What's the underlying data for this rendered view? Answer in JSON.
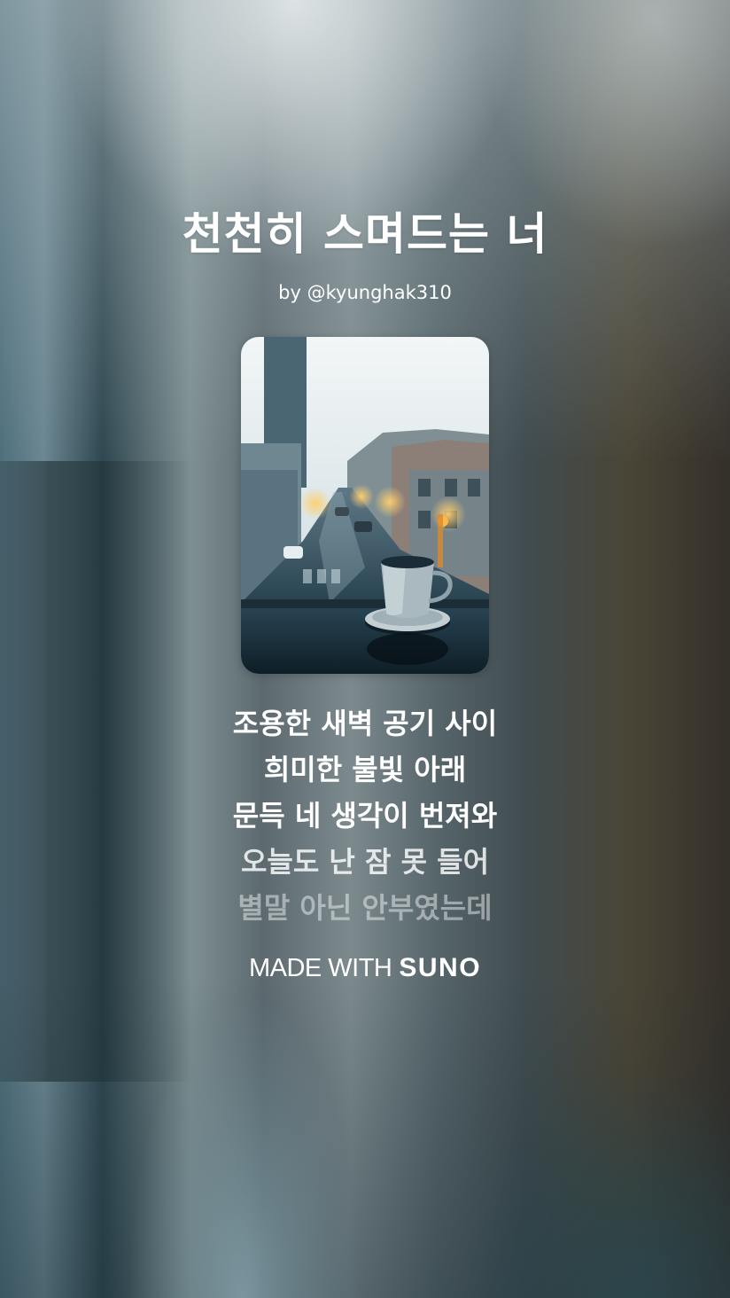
{
  "song": {
    "title": "천천히 스며드는 너",
    "byline": "by @kyunghak310"
  },
  "cover_art": {
    "icon": "cover-art-image",
    "description_colors": {
      "sky": "#dfe9ec",
      "building": "#4a6670",
      "street": "#2c4a58",
      "light": "#f2a23a"
    }
  },
  "lyrics": {
    "lines": [
      "조용한 새벽 공기 사이",
      "희미한 불빛 아래",
      "문득 네 생각이 번져와",
      "오늘도 난 잠 못 들어",
      "별말 아닌 안부였는데"
    ]
  },
  "branding": {
    "made_with": "MADE WITH",
    "brand_name": "SUNO"
  }
}
